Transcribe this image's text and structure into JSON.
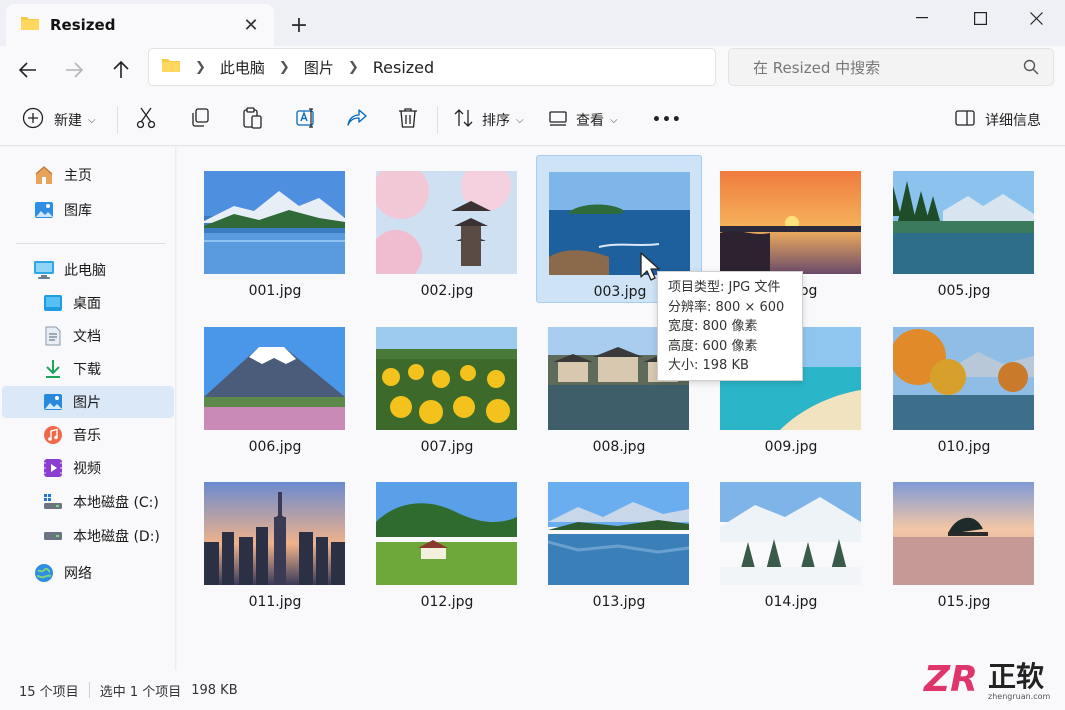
{
  "window": {
    "tab_title": "Resized",
    "tab_close": "✕",
    "new_tab": "+",
    "min": "—",
    "max": "☐",
    "close": "✕"
  },
  "address": {
    "crumbs": [
      "此电脑",
      "图片",
      "Resized"
    ],
    "search_placeholder": "在 Resized 中搜索"
  },
  "toolbar": {
    "new_label": "新建",
    "sort_label": "排序",
    "view_label": "查看",
    "more": "•••",
    "details_label": "详细信息"
  },
  "sidebar": {
    "items": [
      {
        "label": "主页",
        "icon": "home-icon"
      },
      {
        "label": "图库",
        "icon": "gallery-icon"
      },
      {
        "label": "此电脑",
        "icon": "this-pc-icon"
      },
      {
        "label": "桌面",
        "icon": "desktop-icon"
      },
      {
        "label": "文档",
        "icon": "documents-icon"
      },
      {
        "label": "下载",
        "icon": "downloads-icon"
      },
      {
        "label": "图片",
        "icon": "pictures-icon"
      },
      {
        "label": "音乐",
        "icon": "music-icon"
      },
      {
        "label": "视频",
        "icon": "videos-icon"
      },
      {
        "label": "本地磁盘 (C:)",
        "icon": "drive-c-icon"
      },
      {
        "label": "本地磁盘 (D:)",
        "icon": "drive-d-icon"
      },
      {
        "label": "网络",
        "icon": "network-icon"
      }
    ]
  },
  "files": [
    {
      "name": "001.jpg"
    },
    {
      "name": "002.jpg"
    },
    {
      "name": "003.jpg"
    },
    {
      "name": "004.jpg"
    },
    {
      "name": "005.jpg"
    },
    {
      "name": "006.jpg"
    },
    {
      "name": "007.jpg"
    },
    {
      "name": "008.jpg"
    },
    {
      "name": "009.jpg"
    },
    {
      "name": "010.jpg"
    },
    {
      "name": "011.jpg"
    },
    {
      "name": "012.jpg"
    },
    {
      "name": "013.jpg"
    },
    {
      "name": "014.jpg"
    },
    {
      "name": "015.jpg"
    }
  ],
  "tooltip": {
    "type": "项目类型: JPG 文件",
    "resolution": "分辨率: 800 × 600",
    "width": "宽度: 800 像素",
    "height": "高度: 600 像素",
    "size": "大小: 198 KB"
  },
  "status": {
    "count": "15 个项目",
    "selection": "选中 1 个项目",
    "size": "198 KB"
  },
  "watermark": {
    "logo_text": "ZR",
    "brand": "正软",
    "domain": "zhengruan.com"
  },
  "colors": {
    "accent": "#0067c0",
    "selection": "#cfe3f7",
    "folder": "#f7c948"
  }
}
